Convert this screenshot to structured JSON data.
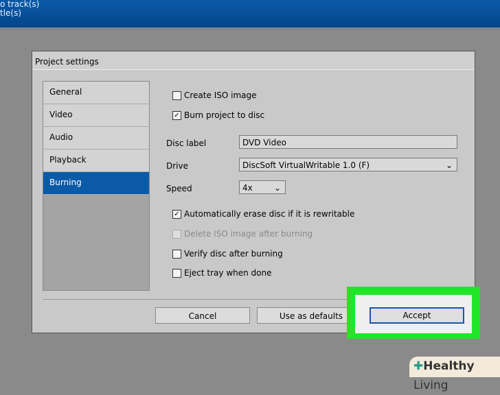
{
  "background": {
    "line1": "o track(s)",
    "line2": "tle(s)"
  },
  "dialog": {
    "title": "Project settings",
    "nav": [
      "General",
      "Video",
      "Audio",
      "Playback",
      "Burning"
    ],
    "checks": {
      "create_iso": "Create ISO image",
      "burn": "Burn project to disc",
      "erase": "Automatically erase disc if it is rewritable",
      "delete_iso": "Delete ISO image after burning",
      "verify": "Verify disc after burning",
      "eject": "Eject tray when done"
    },
    "disc_label": {
      "label": "Disc label",
      "value": "DVD Video"
    },
    "drive": {
      "label": "Drive",
      "value": "DiscSoft VirtualWritable 1.0 (F)"
    },
    "speed": {
      "label": "Speed",
      "value": "4x"
    },
    "buttons": {
      "cancel": "Cancel",
      "defaults": "Use as defaults",
      "accept": "Accept"
    }
  },
  "watermark": {
    "brand": "Healthy",
    "brand2": "Living"
  },
  "colors": {
    "highlight": "#21e627",
    "selection": "#0b5aa8"
  }
}
